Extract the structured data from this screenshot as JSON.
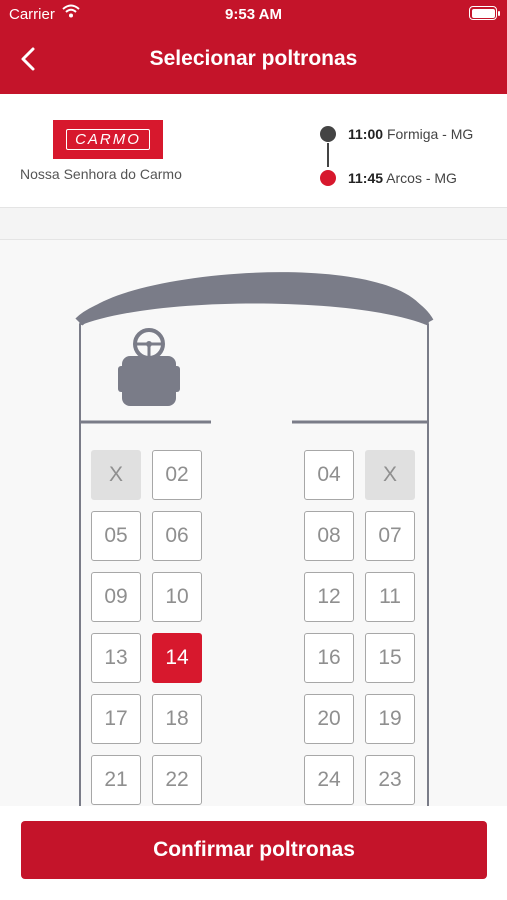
{
  "status_bar": {
    "carrier": "Carrier",
    "time": "9:53 AM"
  },
  "header": {
    "title": "Selecionar poltronas"
  },
  "company": {
    "logo_text": "CARMO",
    "name": "Nossa Senhora do Carmo"
  },
  "route": {
    "departure": {
      "time": "11:00",
      "place": "Formiga - MG",
      "color": "#444444"
    },
    "arrival": {
      "time": "11:45",
      "place": "Arcos - MG",
      "color": "#d7182d"
    }
  },
  "seats": {
    "rows": [
      {
        "left": [
          {
            "label": "X",
            "state": "taken"
          },
          {
            "label": "02",
            "state": "free"
          }
        ],
        "right": [
          {
            "label": "04",
            "state": "free"
          },
          {
            "label": "X",
            "state": "taken"
          }
        ]
      },
      {
        "left": [
          {
            "label": "05",
            "state": "free"
          },
          {
            "label": "06",
            "state": "free"
          }
        ],
        "right": [
          {
            "label": "08",
            "state": "free"
          },
          {
            "label": "07",
            "state": "free"
          }
        ]
      },
      {
        "left": [
          {
            "label": "09",
            "state": "free"
          },
          {
            "label": "10",
            "state": "free"
          }
        ],
        "right": [
          {
            "label": "12",
            "state": "free"
          },
          {
            "label": "11",
            "state": "free"
          }
        ]
      },
      {
        "left": [
          {
            "label": "13",
            "state": "free"
          },
          {
            "label": "14",
            "state": "selected"
          }
        ],
        "right": [
          {
            "label": "16",
            "state": "free"
          },
          {
            "label": "15",
            "state": "free"
          }
        ]
      },
      {
        "left": [
          {
            "label": "17",
            "state": "free"
          },
          {
            "label": "18",
            "state": "free"
          }
        ],
        "right": [
          {
            "label": "20",
            "state": "free"
          },
          {
            "label": "19",
            "state": "free"
          }
        ]
      },
      {
        "left": [
          {
            "label": "21",
            "state": "free"
          },
          {
            "label": "22",
            "state": "free"
          }
        ],
        "right": [
          {
            "label": "24",
            "state": "free"
          },
          {
            "label": "23",
            "state": "free"
          }
        ]
      }
    ]
  },
  "footer": {
    "confirm_label": "Confirmar poltronas"
  },
  "colors": {
    "brand": "#c4142a",
    "seat_selected": "#d7182d",
    "seat_taken": "#e0e0e0",
    "bus_outline": "#7a7c88"
  }
}
